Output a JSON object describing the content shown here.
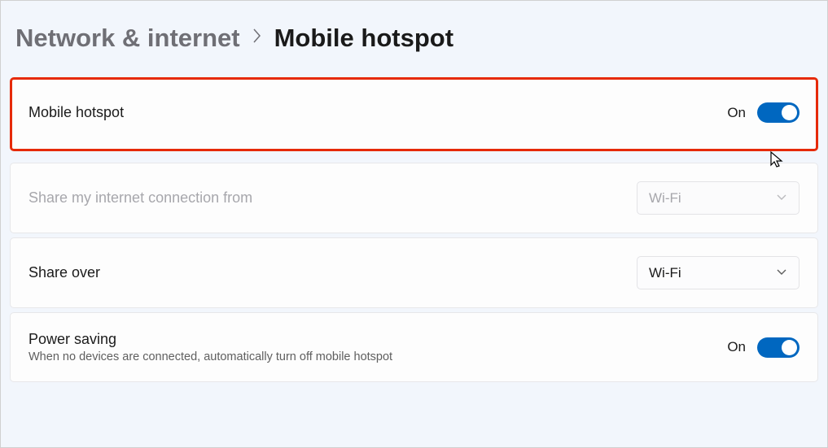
{
  "header": {
    "parent": "Network & internet",
    "current": "Mobile hotspot"
  },
  "hotspot": {
    "label": "Mobile hotspot",
    "state": "On"
  },
  "shareFrom": {
    "label": "Share my internet connection from",
    "value": "Wi-Fi"
  },
  "shareOver": {
    "label": "Share over",
    "value": "Wi-Fi"
  },
  "powerSaving": {
    "label": "Power saving",
    "description": "When no devices are connected, automatically turn off mobile hotspot",
    "state": "On"
  }
}
